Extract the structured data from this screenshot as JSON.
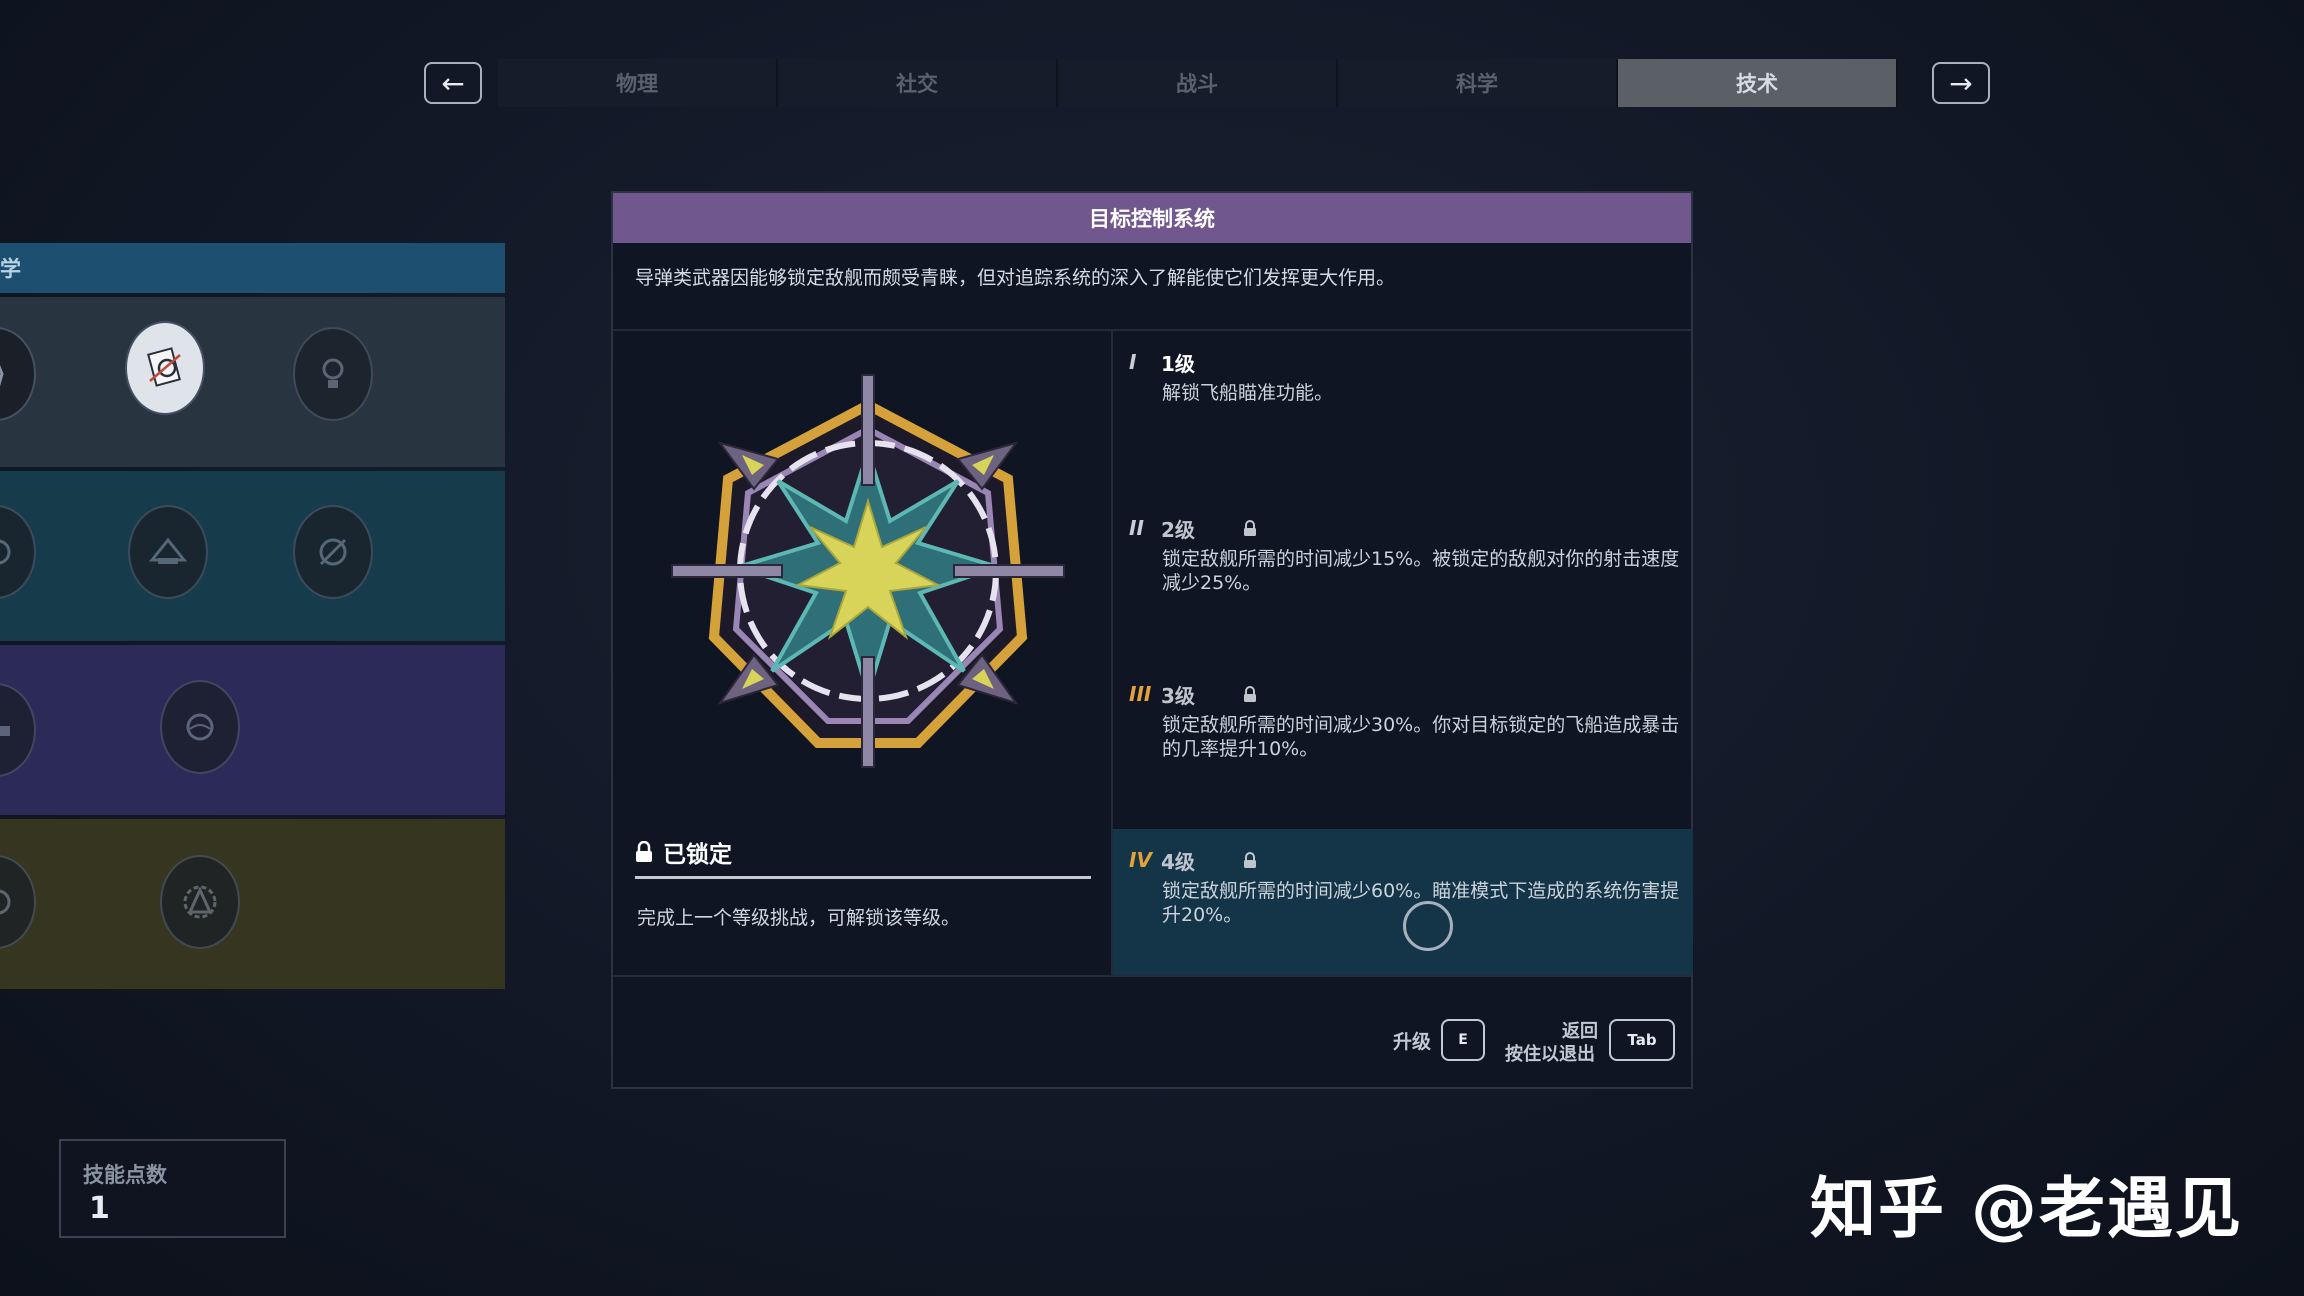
{
  "nav": {
    "prev_arrow": "←",
    "next_arrow": "→",
    "tabs": [
      {
        "label": "物理",
        "active": false
      },
      {
        "label": "社交",
        "active": false
      },
      {
        "label": "战斗",
        "active": false
      },
      {
        "label": "科学",
        "active": false
      },
      {
        "label": "技术",
        "active": true
      }
    ]
  },
  "left_column": {
    "header": "学"
  },
  "panel": {
    "title": "目标控制系统",
    "description": "导弹类武器因能够锁定敌舰而颇受青睐，但对追踪系统的深入了解能使它们发挥更大作用。",
    "status": "已锁定",
    "status_hint": "完成上一个等级挑战，可解锁该等级。",
    "levels": [
      {
        "numeral": "I",
        "name": "1级",
        "locked": false,
        "text": "解锁飞船瞄准功能。"
      },
      {
        "numeral": "II",
        "name": "2级",
        "locked": true,
        "text": "锁定敌舰所需的时间减少15%。被锁定的敌舰对你的射击速度减少25%。"
      },
      {
        "numeral": "III",
        "name": "3级",
        "locked": true,
        "text": "锁定敌舰所需的时间减少30%。你对目标锁定的飞船造成暴击的几率提升10%。"
      },
      {
        "numeral": "IV",
        "name": "4级",
        "locked": true,
        "text": "锁定敌舰所需的时间减少60%。瞄准模式下造成的系统伤害提升20%。"
      }
    ],
    "actions": {
      "upgrade_label": "升级",
      "upgrade_key": "E",
      "back_label": "返回",
      "hold_exit_label": "按住以退出",
      "back_key": "Tab"
    }
  },
  "skill_points": {
    "label": "技能点数",
    "value": "1"
  },
  "watermark": "知乎 @老遇见",
  "colors": {
    "title_bar": "#70588e",
    "selected_level": "#143548",
    "accent_orange": "#e6a23a"
  }
}
